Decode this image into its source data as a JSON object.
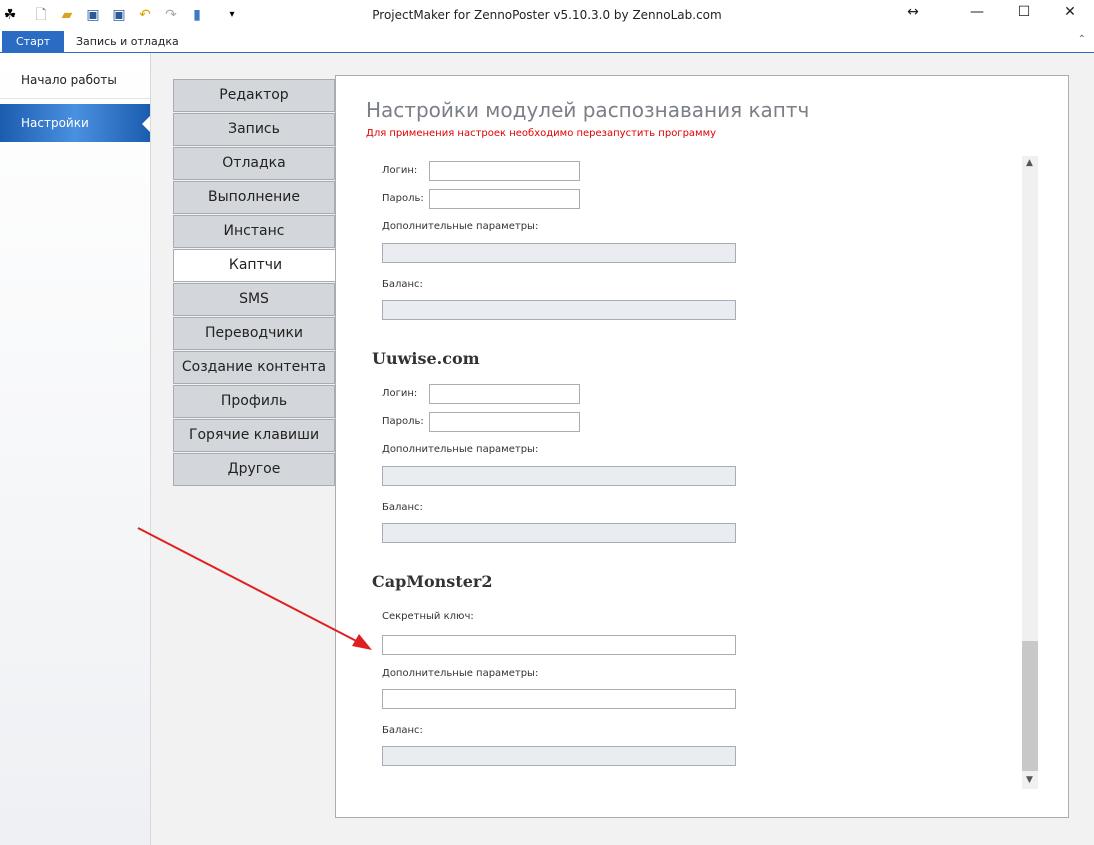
{
  "window": {
    "title": "ProjectMaker for ZennoPoster v5.10.3.0 by ZennoLab.com"
  },
  "ribbon_tabs": [
    "Старт",
    "Запись и отладка"
  ],
  "sidebar": {
    "items": [
      "Начало работы",
      "Настройки"
    ]
  },
  "settings_tabs": [
    "Редактор",
    "Запись",
    "Отладка",
    "Выполнение",
    "Инстанс",
    "Каптчи",
    "SMS",
    "Переводчики",
    "Создание контента",
    "Профиль",
    "Горячие клавиши",
    "Другое"
  ],
  "panel": {
    "title": "Настройки модулей распознавания каптч",
    "warning": "Для применения настроек необходимо перезапустить программу",
    "labels": {
      "login": "Логин:",
      "password": "Пароль:",
      "extra": "Дополнительные параметры:",
      "balance": "Баланс:",
      "secret": "Секретный ключ:"
    },
    "sections": [
      "Uuwise.com",
      "CapMonster2"
    ]
  },
  "colors": {
    "accent": "#1a5fb4",
    "warning": "#e00000",
    "arrow": "#e02020"
  }
}
